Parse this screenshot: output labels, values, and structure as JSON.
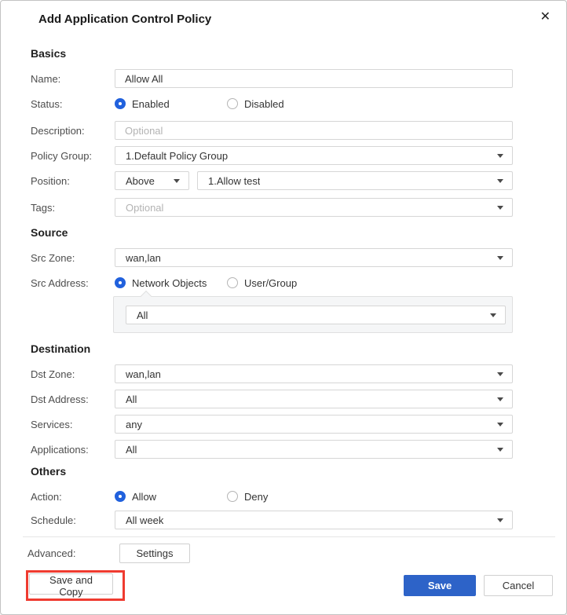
{
  "dialog": {
    "title": "Add Application Control Policy",
    "close_icon": "✕"
  },
  "basics": {
    "header": "Basics",
    "name": {
      "label": "Name:",
      "value": "Allow All"
    },
    "status": {
      "label": "Status:",
      "options": [
        {
          "label": "Enabled",
          "selected": true
        },
        {
          "label": "Disabled",
          "selected": false
        }
      ]
    },
    "description": {
      "label": "Description:",
      "placeholder": "Optional",
      "value": ""
    },
    "policy_group": {
      "label": "Policy Group:",
      "value": "1.Default Policy Group"
    },
    "position": {
      "label": "Position:",
      "value": "Above",
      "target_value": "1.Allow test"
    },
    "tags": {
      "label": "Tags:",
      "placeholder": "Optional"
    }
  },
  "source": {
    "header": "Source",
    "src_zone": {
      "label": "Src Zone:",
      "value": "wan,lan"
    },
    "src_address": {
      "label": "Src Address:",
      "options": [
        {
          "label": "Network Objects",
          "selected": true
        },
        {
          "label": "User/Group",
          "selected": false
        }
      ],
      "network_objects_value": "All"
    }
  },
  "destination": {
    "header": "Destination",
    "dst_zone": {
      "label": "Dst Zone:",
      "value": "wan,lan"
    },
    "dst_address": {
      "label": "Dst Address:",
      "value": "All"
    },
    "services": {
      "label": "Services:",
      "value": "any"
    },
    "applications": {
      "label": "Applications:",
      "value": "All"
    }
  },
  "others": {
    "header": "Others",
    "action": {
      "label": "Action:",
      "options": [
        {
          "label": "Allow",
          "selected": true
        },
        {
          "label": "Deny",
          "selected": false
        }
      ]
    },
    "schedule": {
      "label": "Schedule:",
      "value": "All week"
    }
  },
  "footer": {
    "advanced_label": "Advanced:",
    "settings_button": "Settings",
    "save_and_copy_button": "Save and Copy",
    "save_button": "Save",
    "cancel_button": "Cancel"
  },
  "colors": {
    "accent_blue": "#2161dd",
    "save_button_bg": "#2d63c8",
    "annotation_red": "#ef3b30"
  }
}
